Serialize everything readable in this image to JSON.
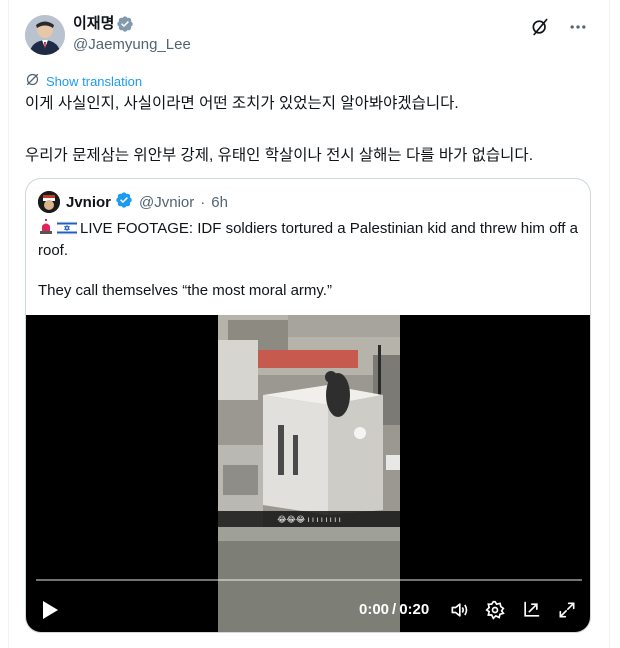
{
  "author": {
    "display_name": "이재명",
    "handle": "@Jaemyung_Lee",
    "verified_icon": "verified-badge-icon",
    "avatar_icon": "profile-photo"
  },
  "actions": {
    "grok_icon": "grok-icon",
    "more_icon": "more-horizontal-icon"
  },
  "translate": {
    "label": "Show translation",
    "icon": "translate-globe-icon"
  },
  "body": {
    "line1": "이게 사실인지, 사실이라면 어떤 조치가 있었는지 알아봐야겠습니다.",
    "line2": "우리가 문제삼는 위안부 강제, 유태인 학살이나 전시 살해는 다를 바가 없습니다."
  },
  "quote": {
    "display_name": "Jvnior",
    "handle": "@Jvnior",
    "dot": "·",
    "time": "6h",
    "line1": "LIVE FOOTAGE: IDF soldiers tortured a Palestinian kid and threw him off a roof.",
    "line2": "They call themselves “the most moral army.”",
    "flag_icons": [
      "siren-icon",
      "israel-flag-icon"
    ]
  },
  "video": {
    "current_time": "0:00",
    "separator": "/",
    "duration": "0:20",
    "progress": 0.0,
    "caption": "😂😂😂 ı ı ı ı ı ı ı ı",
    "controls": [
      "play-icon",
      "volume-icon",
      "settings-icon",
      "popout-icon",
      "fullscreen-icon"
    ]
  },
  "colors": {
    "accent": "#1d9bf0",
    "secondary_text": "#536471",
    "border": "#cfd9de"
  }
}
